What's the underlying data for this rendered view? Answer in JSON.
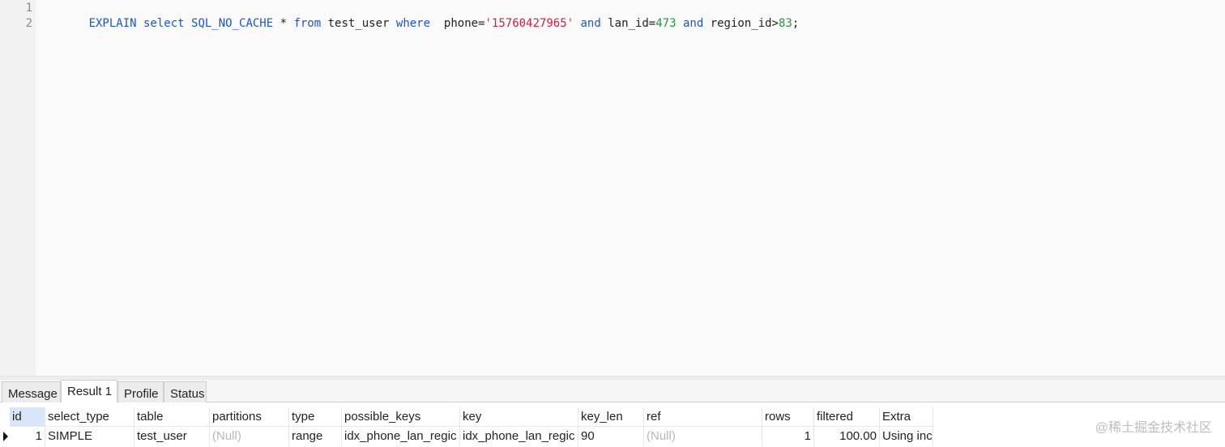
{
  "editor": {
    "line_numbers": [
      "1",
      "2"
    ],
    "sql_tokens": [
      {
        "t": "EXPLAIN select SQL_NO_CACHE",
        "c": "kw"
      },
      {
        "t": " * ",
        "c": "plain"
      },
      {
        "t": "from",
        "c": "kw"
      },
      {
        "t": " test_user ",
        "c": "plain"
      },
      {
        "t": "where",
        "c": "kw"
      },
      {
        "t": "  phone=",
        "c": "plain"
      },
      {
        "t": "'15760427965'",
        "c": "str"
      },
      {
        "t": " ",
        "c": "plain"
      },
      {
        "t": "and",
        "c": "kw"
      },
      {
        "t": " lan_id=",
        "c": "plain"
      },
      {
        "t": "473",
        "c": "num"
      },
      {
        "t": " ",
        "c": "plain"
      },
      {
        "t": "and",
        "c": "kw"
      },
      {
        "t": " region_id>",
        "c": "plain"
      },
      {
        "t": "83",
        "c": "num"
      },
      {
        "t": ";",
        "c": "plain"
      }
    ]
  },
  "tabs": [
    {
      "label": "Message",
      "active": false
    },
    {
      "label": "Result 1",
      "active": true
    },
    {
      "label": "Profile",
      "active": false
    },
    {
      "label": "Status",
      "active": false
    }
  ],
  "result": {
    "columns": [
      "id",
      "select_type",
      "table",
      "partitions",
      "type",
      "possible_keys",
      "key",
      "key_len",
      "ref",
      "rows",
      "filtered",
      "Extra"
    ],
    "rows": [
      [
        "1",
        "SIMPLE",
        "test_user",
        "(Null)",
        "range",
        "idx_phone_lan_regic",
        "idx_phone_lan_regic",
        "90",
        "(Null)",
        "1",
        "100.00",
        "Using inc"
      ]
    ]
  },
  "watermark": "@稀土掘金技术社区",
  "colors": {
    "keyword": "#1a56c9",
    "string": "#d21f3c",
    "number": "#1f9a3a",
    "selected_header": "#d8e6f8"
  }
}
